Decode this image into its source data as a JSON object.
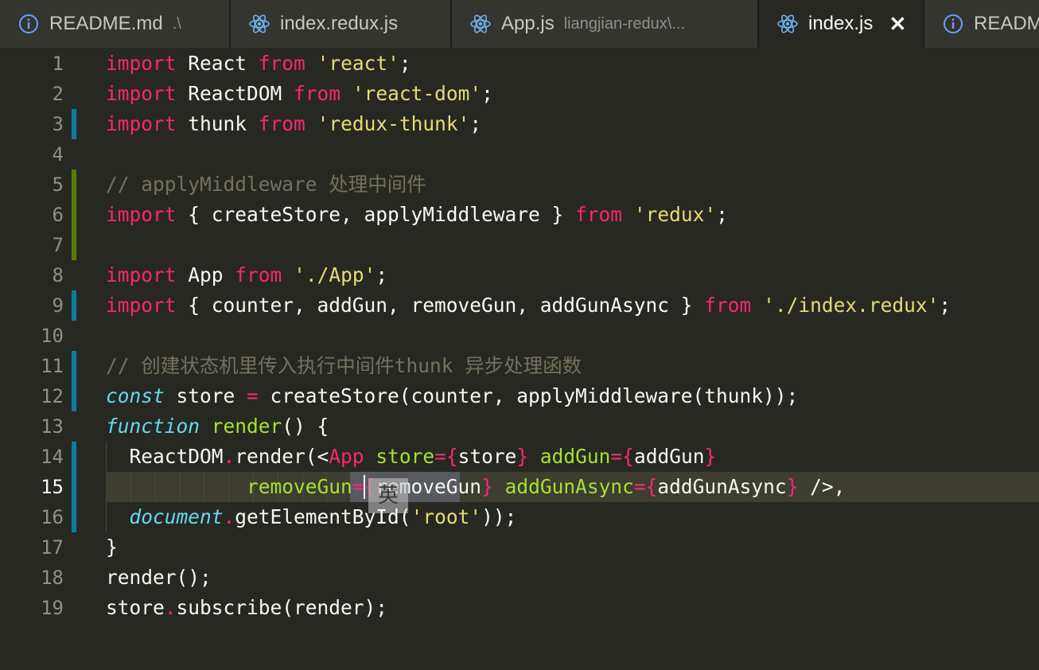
{
  "tabs": [
    {
      "label": "README.md",
      "desc": ".\\",
      "icon": "info-icon",
      "active": false
    },
    {
      "label": "index.redux.js",
      "desc": "",
      "icon": "react-icon",
      "active": false
    },
    {
      "label": "App.js",
      "desc": "liangjian-redux\\...",
      "icon": "react-icon",
      "active": false
    },
    {
      "label": "index.js",
      "desc": "",
      "icon": "react-icon",
      "active": true,
      "close": "✕"
    },
    {
      "label": "READM",
      "desc": "",
      "icon": "info-icon",
      "active": false
    }
  ],
  "editor": {
    "current_line": 15,
    "ime_char": "英",
    "lines": [
      {
        "n": "1",
        "tokens": [
          [
            "kw",
            "import"
          ],
          [
            "pl",
            " React "
          ],
          [
            "kw",
            "from"
          ],
          [
            "pl",
            " "
          ],
          [
            "str",
            "'react'"
          ],
          [
            "pl",
            ";"
          ]
        ]
      },
      {
        "n": "2",
        "tokens": [
          [
            "kw",
            "import"
          ],
          [
            "pl",
            " ReactDOM "
          ],
          [
            "kw",
            "from"
          ],
          [
            "pl",
            " "
          ],
          [
            "str",
            "'react-dom'"
          ],
          [
            "pl",
            ";"
          ]
        ]
      },
      {
        "n": "3",
        "tokens": [
          [
            "kw",
            "import"
          ],
          [
            "pl",
            " thunk "
          ],
          [
            "kw",
            "from"
          ],
          [
            "pl",
            " "
          ],
          [
            "str",
            "'redux-thunk'"
          ],
          [
            "pl",
            ";"
          ]
        ]
      },
      {
        "n": "4",
        "tokens": []
      },
      {
        "n": "5",
        "tokens": [
          [
            "cm",
            "// applyMiddleware 处理中间件"
          ]
        ]
      },
      {
        "n": "6",
        "tokens": [
          [
            "kw",
            "import"
          ],
          [
            "pl",
            " { createStore, applyMiddleware } "
          ],
          [
            "kw",
            "from"
          ],
          [
            "pl",
            " "
          ],
          [
            "str",
            "'redux'"
          ],
          [
            "pl",
            ";"
          ]
        ]
      },
      {
        "n": "7",
        "tokens": []
      },
      {
        "n": "8",
        "tokens": [
          [
            "kw",
            "import"
          ],
          [
            "pl",
            " App "
          ],
          [
            "kw",
            "from"
          ],
          [
            "pl",
            " "
          ],
          [
            "str",
            "'./App'"
          ],
          [
            "pl",
            ";"
          ]
        ]
      },
      {
        "n": "9",
        "tokens": [
          [
            "kw",
            "import"
          ],
          [
            "pl",
            " { counter, addGun, removeGun, addGunAsync } "
          ],
          [
            "kw",
            "from"
          ],
          [
            "pl",
            " "
          ],
          [
            "str",
            "'./index.redux'"
          ],
          [
            "pl",
            ";"
          ]
        ]
      },
      {
        "n": "10",
        "tokens": []
      },
      {
        "n": "11",
        "tokens": [
          [
            "cm",
            "// 创建状态机里传入执行中间件thunk 异步处理函数"
          ]
        ]
      },
      {
        "n": "12",
        "tokens": [
          [
            "st",
            "const"
          ],
          [
            "pl",
            " store "
          ],
          [
            "op",
            "="
          ],
          [
            "pl",
            " createStore(counter, applyMiddleware(thunk));"
          ]
        ]
      },
      {
        "n": "13",
        "tokens": [
          [
            "st",
            "function"
          ],
          [
            "pl",
            " "
          ],
          [
            "fn",
            "render"
          ],
          [
            "pl",
            "() {"
          ]
        ]
      },
      {
        "n": "14",
        "tokens": [
          [
            "pl",
            "  ReactDOM"
          ],
          [
            "op",
            "."
          ],
          [
            "pl",
            "render(<"
          ],
          [
            "tag",
            "App"
          ],
          [
            "pl",
            " "
          ],
          [
            "attr",
            "store"
          ],
          [
            "op",
            "={"
          ],
          [
            "pl",
            "store"
          ],
          [
            "op",
            "}"
          ],
          [
            "pl",
            " "
          ],
          [
            "attr",
            "addGun"
          ],
          [
            "op",
            "={"
          ],
          [
            "pl",
            "addGun"
          ],
          [
            "op",
            "}"
          ]
        ]
      },
      {
        "n": "15",
        "tokens": [
          [
            "pl",
            "            "
          ],
          [
            "attr",
            "removeGun"
          ],
          [
            "op",
            "={"
          ],
          [
            "pl",
            "removeGun"
          ],
          [
            "op",
            "}"
          ],
          [
            "pl",
            " "
          ],
          [
            "attr",
            "addGunAsync"
          ],
          [
            "op",
            "={"
          ],
          [
            "pl",
            "addGunAsync"
          ],
          [
            "op",
            "}"
          ],
          [
            "pl",
            " />,"
          ]
        ]
      },
      {
        "n": "16",
        "tokens": [
          [
            "pl",
            "  "
          ],
          [
            "st",
            "document"
          ],
          [
            "op",
            "."
          ],
          [
            "pl",
            "getElementById("
          ],
          [
            "str",
            "'root'"
          ],
          [
            "pl",
            "));"
          ]
        ]
      },
      {
        "n": "17",
        "tokens": [
          [
            "pl",
            "}"
          ]
        ]
      },
      {
        "n": "18",
        "tokens": [
          [
            "pl",
            "render();"
          ]
        ]
      },
      {
        "n": "19",
        "tokens": [
          [
            "pl",
            "store"
          ],
          [
            "op",
            "."
          ],
          [
            "pl",
            "subscribe(render);"
          ]
        ]
      }
    ],
    "dirty_markers": [
      {
        "from": 3,
        "to": 3,
        "kind": "mod"
      },
      {
        "from": 5,
        "to": 7,
        "kind": "add"
      },
      {
        "from": 9,
        "to": 9,
        "kind": "mod"
      },
      {
        "from": 11,
        "to": 12,
        "kind": "mod"
      },
      {
        "from": 14,
        "to": 16,
        "kind": "mod"
      }
    ]
  },
  "colors": {
    "background": "#272822",
    "keyword": "#f92672",
    "string": "#e6db74",
    "comment": "#75715e",
    "storage": "#66d9ef",
    "function": "#a6e22e"
  }
}
